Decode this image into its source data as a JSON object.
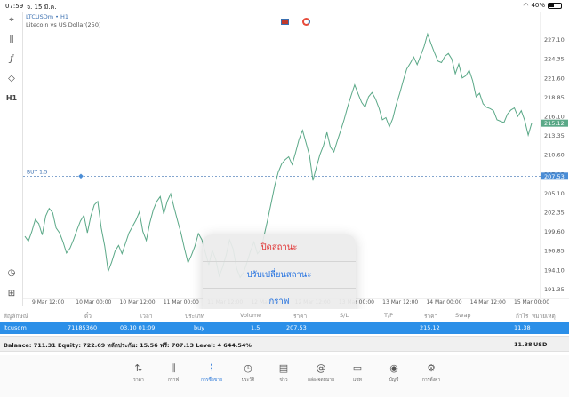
{
  "status_bar": {
    "time": "07:59",
    "date": "จ. 15 มี.ค.",
    "battery": "40%"
  },
  "left_toolbar": {
    "items": [
      {
        "icon": "crosshair-icon",
        "glyph": "⌖"
      },
      {
        "icon": "candles-icon",
        "glyph": "⫼"
      },
      {
        "icon": "function-icon",
        "glyph": "ƒ"
      },
      {
        "icon": "objects-icon",
        "glyph": "◇"
      },
      {
        "icon": "timeframe-icon",
        "glyph": "H1"
      },
      {
        "icon": "oscillator-icon",
        "glyph": "◷"
      },
      {
        "icon": "add-chart-icon",
        "glyph": "⊞"
      }
    ]
  },
  "chart": {
    "symbol_title": "LTCUSDm • H1",
    "subtitle": "Litecoin vs US Dollar(250)",
    "position_label": "BUY 1.5",
    "current_price_label": "215.12",
    "buy_price_label": "207.53",
    "colors": {
      "line": "#5aa887",
      "price_tag": "#5aa887",
      "buy_line": "#3a6fb0",
      "buy_tag": "#4a8dd6"
    }
  },
  "chart_data": {
    "type": "line",
    "series": [
      {
        "values": [
          198.9,
          198.2,
          199.6,
          201.3,
          200.7,
          199.1,
          201.8,
          202.9,
          202.3,
          200.1,
          199.4,
          198.1,
          196.5,
          197.2,
          198.4,
          199.8,
          201.1,
          201.9,
          199.4,
          201.8,
          203.4,
          203.9,
          200.1,
          197.5,
          193.9,
          195.2,
          196.8,
          197.6,
          196.4,
          197.9,
          199.4,
          200.3,
          201.2,
          202.4,
          199.6,
          198.3,
          200.8,
          202.7,
          203.9,
          204.6,
          202.1,
          203.9,
          205.0,
          203.0,
          201.1,
          199.3,
          197.1,
          195.1,
          196.2,
          197.5,
          199.3,
          198.4,
          196.6,
          194.8,
          196.9,
          195.6,
          193.2,
          194.5,
          196.2,
          198.4,
          197.1,
          194.3,
          193.0,
          193.7,
          195.2,
          196.8,
          198.1,
          196.4,
          197.0,
          199.2,
          201.4,
          203.8,
          206.2,
          208.1,
          209.3,
          209.9,
          210.3,
          209.2,
          210.9,
          212.8,
          214.1,
          212.3,
          210.5,
          206.9,
          208.8,
          210.6,
          211.9,
          213.8,
          211.7,
          211.0,
          212.6,
          214.1,
          215.7,
          217.5,
          219.1,
          220.6,
          219.3,
          218.1,
          217.4,
          218.9,
          219.5,
          218.6,
          217.3,
          215.6,
          215.9,
          214.6,
          215.8,
          217.8,
          219.4,
          221.2,
          222.9,
          223.7,
          224.6,
          223.5,
          224.8,
          226.1,
          227.9,
          226.5,
          225.2,
          224.0,
          223.8,
          224.7,
          225.1,
          224.3,
          222.2,
          223.6,
          221.6,
          221.9,
          222.7,
          221.2,
          218.9,
          219.4,
          217.9,
          217.4,
          217.2,
          216.9,
          215.6,
          215.4,
          215.2,
          216.4,
          217.0,
          217.3,
          216.1,
          216.9,
          215.5,
          213.4,
          215.1
        ]
      }
    ],
    "y_ticks": [
      "227.10",
      "224.35",
      "221.60",
      "218.85",
      "216.10",
      "213.35",
      "210.60",
      "207.85",
      "205.10",
      "202.35",
      "199.60",
      "196.85",
      "194.10",
      "191.35"
    ],
    "x_ticks": [
      "9 Mar 12:00",
      "10 Mar 00:00",
      "10 Mar 12:00",
      "11 Mar 00:00",
      "11 Mar 12:00",
      "12 Mar 00:00",
      "12 Mar 12:00",
      "13 Mar 00:00",
      "13 Mar 12:00",
      "14 Mar 00:00",
      "14 Mar 12:00",
      "15 Mar 00:00"
    ],
    "ylim": [
      190.0,
      228.7
    ],
    "current_price": 215.12,
    "buy_price": 207.53
  },
  "action_sheet": {
    "items": [
      {
        "label": "ปิดสถานะ",
        "style": "danger"
      },
      {
        "label": "ปรับเปลี่ยนสถานะ",
        "style": "action"
      },
      {
        "label": "กราฟ",
        "style": "action"
      }
    ]
  },
  "positions_table": {
    "headers": [
      "สัญลักษณ์",
      "ตั๋ว",
      "เวลา",
      "ประเภท",
      "Volume",
      "ราคา",
      "S/L",
      "T/P",
      "ราคา",
      "Swap",
      "กำไร",
      "หมายเหตุ"
    ],
    "row": {
      "symbol": "ltcusdm",
      "ticket": "71185360",
      "time": "03.10 01:09",
      "type": "buy",
      "volume": "1.5",
      "price": "207.53",
      "current": "215.12",
      "profit": "11.38"
    }
  },
  "balance_bar": {
    "text": "Balance: 711.31 Equity: 722.69 หลักประกัน: 15.56 ฟรี: 707.13 Level: 4 644.54%",
    "total": "11.38",
    "currency": "USD"
  },
  "tabbar": {
    "tabs": [
      {
        "label": "ราคา",
        "icon": "quotes-icon",
        "glyph": "⇅"
      },
      {
        "label": "กราฟ",
        "icon": "chart-icon",
        "glyph": "⫼"
      },
      {
        "label": "การซื้อขาย",
        "icon": "trade-icon",
        "glyph": "⌇",
        "active": true
      },
      {
        "label": "ประวัติ",
        "icon": "history-icon",
        "glyph": "◷"
      },
      {
        "label": "ข่าว",
        "icon": "news-icon",
        "glyph": "▤"
      },
      {
        "label": "กล่องจดหมาย",
        "icon": "mailbox-icon",
        "glyph": "@"
      },
      {
        "label": "แชท",
        "icon": "chat-icon",
        "glyph": "▭"
      },
      {
        "label": "บัญชี",
        "icon": "account-icon",
        "glyph": "◉"
      },
      {
        "label": "การตั้งค่า",
        "icon": "settings-icon",
        "glyph": "⚙"
      }
    ]
  }
}
